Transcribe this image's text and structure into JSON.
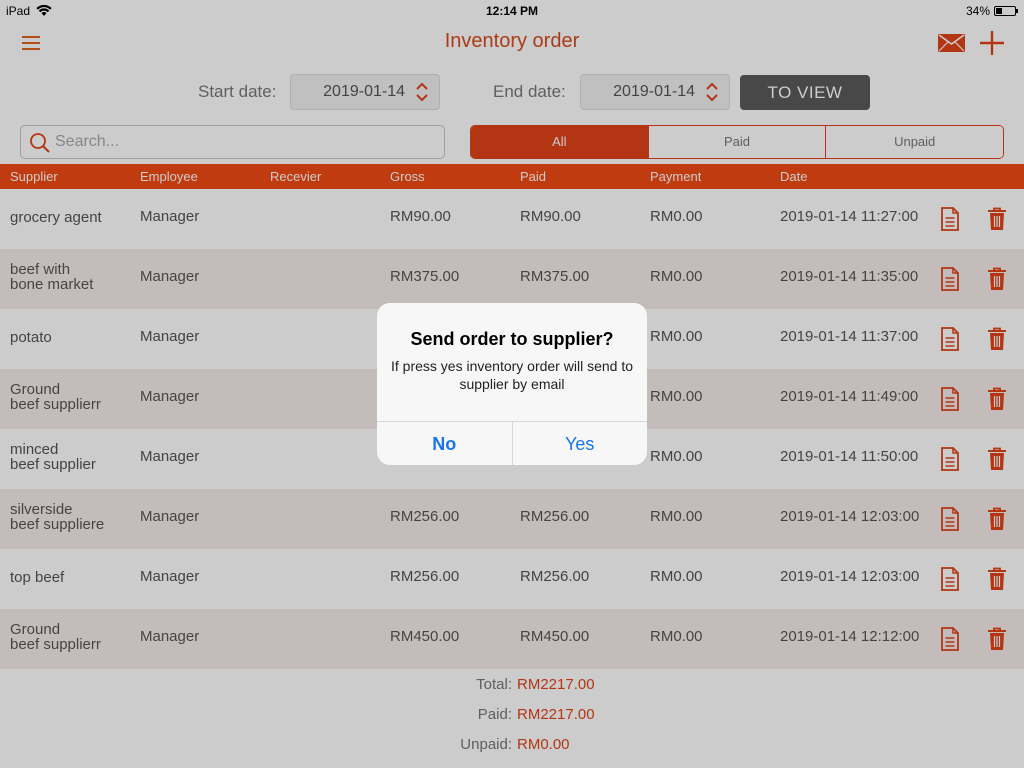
{
  "statusbar": {
    "device": "iPad",
    "time": "12:14 PM",
    "battery": "34%",
    "battery_level": 0.34
  },
  "navbar": {
    "title": "Inventory order"
  },
  "filters": {
    "start_label": "Start date:",
    "start_value": "2019-01-14",
    "end_label": "End date:",
    "end_value": "2019-01-14",
    "view_button": "TO VIEW"
  },
  "search": {
    "placeholder": "Search..."
  },
  "segments": [
    "All",
    "Paid",
    "Unpaid"
  ],
  "table": {
    "headers": [
      "Supplier",
      "Employee",
      "Recevier",
      "Gross",
      "Paid",
      "Payment",
      "Date"
    ],
    "rows": [
      {
        "supplier": [
          "grocery agent"
        ],
        "employee": "Manager",
        "receiver": "",
        "gross": "RM90.00",
        "paid": "RM90.00",
        "payment": "RM0.00",
        "date": "2019-01-14 11:27:00"
      },
      {
        "supplier": [
          "beef with",
          "bone market"
        ],
        "employee": "Manager",
        "receiver": "",
        "gross": "RM375.00",
        "paid": "RM375.00",
        "payment": "RM0.00",
        "date": "2019-01-14 11:35:00"
      },
      {
        "supplier": [
          "potato"
        ],
        "employee": "Manager",
        "receiver": "",
        "gross": "",
        "paid": "",
        "payment": "RM0.00",
        "date": "2019-01-14 11:37:00"
      },
      {
        "supplier": [
          "Ground",
          "beef supplierr"
        ],
        "employee": "Manager",
        "receiver": "",
        "gross": "",
        "paid": "",
        "payment": "RM0.00",
        "date": "2019-01-14 11:49:00"
      },
      {
        "supplier": [
          "minced",
          "beef supplier"
        ],
        "employee": "Manager",
        "receiver": "",
        "gross": "",
        "paid": "",
        "payment": "RM0.00",
        "date": "2019-01-14 11:50:00"
      },
      {
        "supplier": [
          "silverside",
          "beef suppliere"
        ],
        "employee": "Manager",
        "receiver": "",
        "gross": "RM256.00",
        "paid": "RM256.00",
        "payment": "RM0.00",
        "date": "2019-01-14 12:03:00"
      },
      {
        "supplier": [
          "top beef"
        ],
        "employee": "Manager",
        "receiver": "",
        "gross": "RM256.00",
        "paid": "RM256.00",
        "payment": "RM0.00",
        "date": "2019-01-14 12:03:00"
      },
      {
        "supplier": [
          "Ground",
          "beef supplierr"
        ],
        "employee": "Manager",
        "receiver": "",
        "gross": "RM450.00",
        "paid": "RM450.00",
        "payment": "RM0.00",
        "date": "2019-01-14 12:12:00"
      }
    ]
  },
  "totals": {
    "total_label": "Total:",
    "total_value": "RM2217.00",
    "paid_label": "Paid:",
    "paid_value": "RM2217.00",
    "unpaid_label": "Unpaid:",
    "unpaid_value": "RM0.00"
  },
  "alert": {
    "title": "Send order to supplier?",
    "message": "If press yes inventory order will send to supplier by email",
    "no_label": "No",
    "yes_label": "Yes"
  },
  "colors": {
    "accent": "#e0431a",
    "header_bg": "#f04a14",
    "link_blue": "#1a73e8"
  },
  "icons": [
    "wifi-icon",
    "menu-icon",
    "mail-icon",
    "plus-icon",
    "stepper-icon",
    "search-icon",
    "document-icon",
    "trash-icon"
  ]
}
